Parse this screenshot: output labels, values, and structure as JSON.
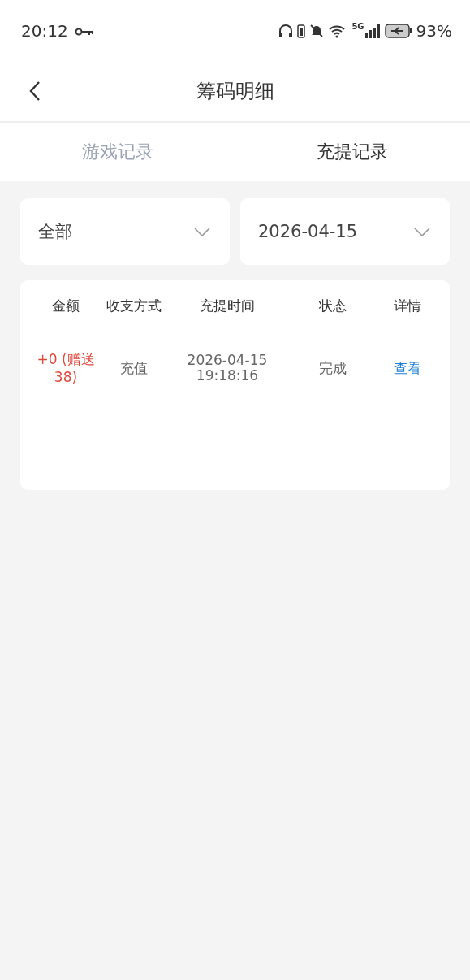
{
  "status_bar": {
    "time": "20:12",
    "network": "5G",
    "battery": "93%"
  },
  "header": {
    "title": "筹码明细"
  },
  "tabs": [
    {
      "label": "游戏记录",
      "selected": false
    },
    {
      "label": "充提记录",
      "selected": true
    }
  ],
  "filters": [
    {
      "value": "全部"
    },
    {
      "value": "2026-04-15"
    }
  ],
  "table": {
    "columns": [
      "金额",
      "收支方式",
      "充提时间",
      "状态",
      "详情"
    ],
    "rows": [
      {
        "amount": "+0 (赠送38)",
        "method": "充值",
        "time": "2026-04-15 19:18:16",
        "status": "完成",
        "detail": "查看"
      }
    ]
  }
}
